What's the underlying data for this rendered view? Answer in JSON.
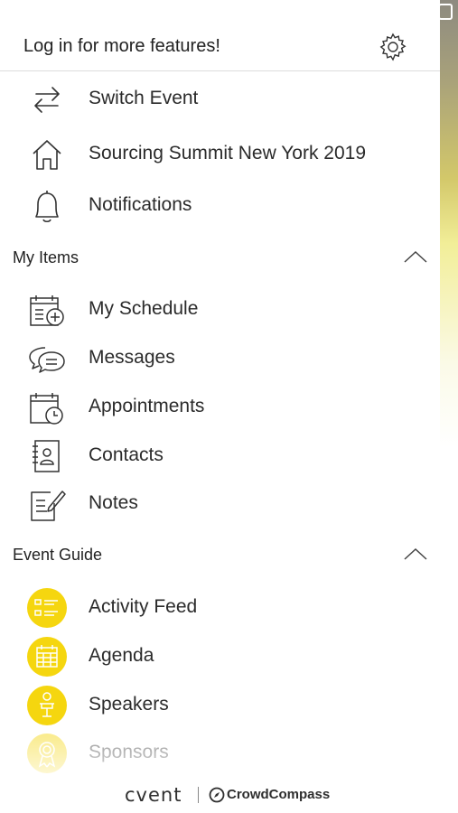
{
  "header": {
    "title": "Log in for more features!",
    "settings_icon": "gear-icon"
  },
  "top_items": [
    {
      "label": "Switch Event",
      "icon": "switch-arrows-icon"
    },
    {
      "label": "Sourcing Summit New York 2019",
      "icon": "home-icon"
    },
    {
      "label": "Notifications",
      "icon": "bell-icon"
    }
  ],
  "my_items": {
    "title": "My Items",
    "items": [
      {
        "label": "My Schedule",
        "icon": "calendar-add-icon"
      },
      {
        "label": "Messages",
        "icon": "chat-bubbles-icon"
      },
      {
        "label": "Appointments",
        "icon": "calendar-clock-icon"
      },
      {
        "label": "Contacts",
        "icon": "contact-book-icon"
      },
      {
        "label": "Notes",
        "icon": "note-edit-icon"
      }
    ]
  },
  "event_guide": {
    "title": "Event Guide",
    "accent_color": "#f5d60f",
    "items": [
      {
        "label": "Activity Feed",
        "icon": "activity-list-icon"
      },
      {
        "label": "Agenda",
        "icon": "agenda-grid-icon"
      },
      {
        "label": "Speakers",
        "icon": "speaker-icon"
      },
      {
        "label": "Sponsors",
        "icon": "sponsor-ribbon-icon"
      }
    ]
  },
  "footer": {
    "brand": "cvent",
    "partner": "CrowdCompass"
  }
}
